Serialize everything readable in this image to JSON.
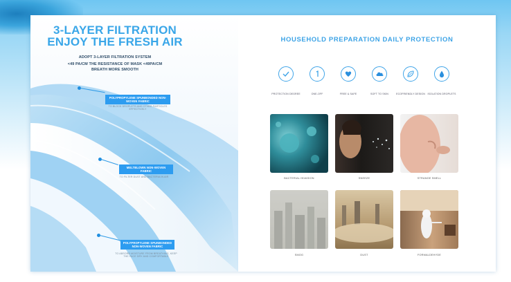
{
  "left": {
    "title_line1": "3-LAYER FILTRATION",
    "title_line2": "ENJOY THE FRESH AIR",
    "sub1": "ADOPT 3-LAYER FILTRATION SYSTEM",
    "sub2": "<49 PA/CM THE RESISTANCE OF MASK <49PA/CM",
    "sub3": "BREATH MORE SMOOTH",
    "callouts": [
      {
        "label": "POLYPROPYLENE SPUNBONDED NON-WOVEN FABRIC",
        "note": "TO BLOCK DROPLETS AND OTHER PARTICLES EFFECTIVELY"
      },
      {
        "label": "MELTBLOWN NON-WOVEN FABRIC",
        "note": "TO FILTER DUST AND BACTERIA IN AIR"
      },
      {
        "label": "POLYPROPYLENE SPUNBONDED NON-WOVEN FABRIC",
        "note": "TO ABSORB MOISTURE FROM BREATHING, KEEP THE FACE DRY AND COMFORTABLE"
      }
    ]
  },
  "right": {
    "title": "HOUSEHOLD PREPARATION  DAILY PROTECTION",
    "icons": [
      {
        "icon": "check-icon",
        "label": "PROTECTION DEGREE"
      },
      {
        "icon": "one-icon",
        "label": "ONE-OFF"
      },
      {
        "icon": "heart-icon",
        "label": "FREE & SAFE"
      },
      {
        "icon": "cloud-icon",
        "label": "SOFT TO SKIN"
      },
      {
        "icon": "leaf-icon",
        "label": "ECOFRIENDLY DESIGN"
      },
      {
        "icon": "drop-icon",
        "label": "ISOLATION DROPLETS"
      }
    ],
    "photos": [
      {
        "name": "bacteria-photo",
        "label": "BACTERIAL INVASION"
      },
      {
        "name": "sneeze-photo",
        "label": "SNEEZE"
      },
      {
        "name": "nose-photo",
        "label": "STRANGE SMELL"
      },
      {
        "name": "smog-photo",
        "label": "SMOG"
      },
      {
        "name": "dust-photo",
        "label": "DUST"
      },
      {
        "name": "disinfect-photo",
        "label": "FORMALDEHYDE"
      }
    ]
  },
  "colors": {
    "accent": "#3ca3e6",
    "callout": "#2d9cf0",
    "text": "#2c4a66"
  }
}
